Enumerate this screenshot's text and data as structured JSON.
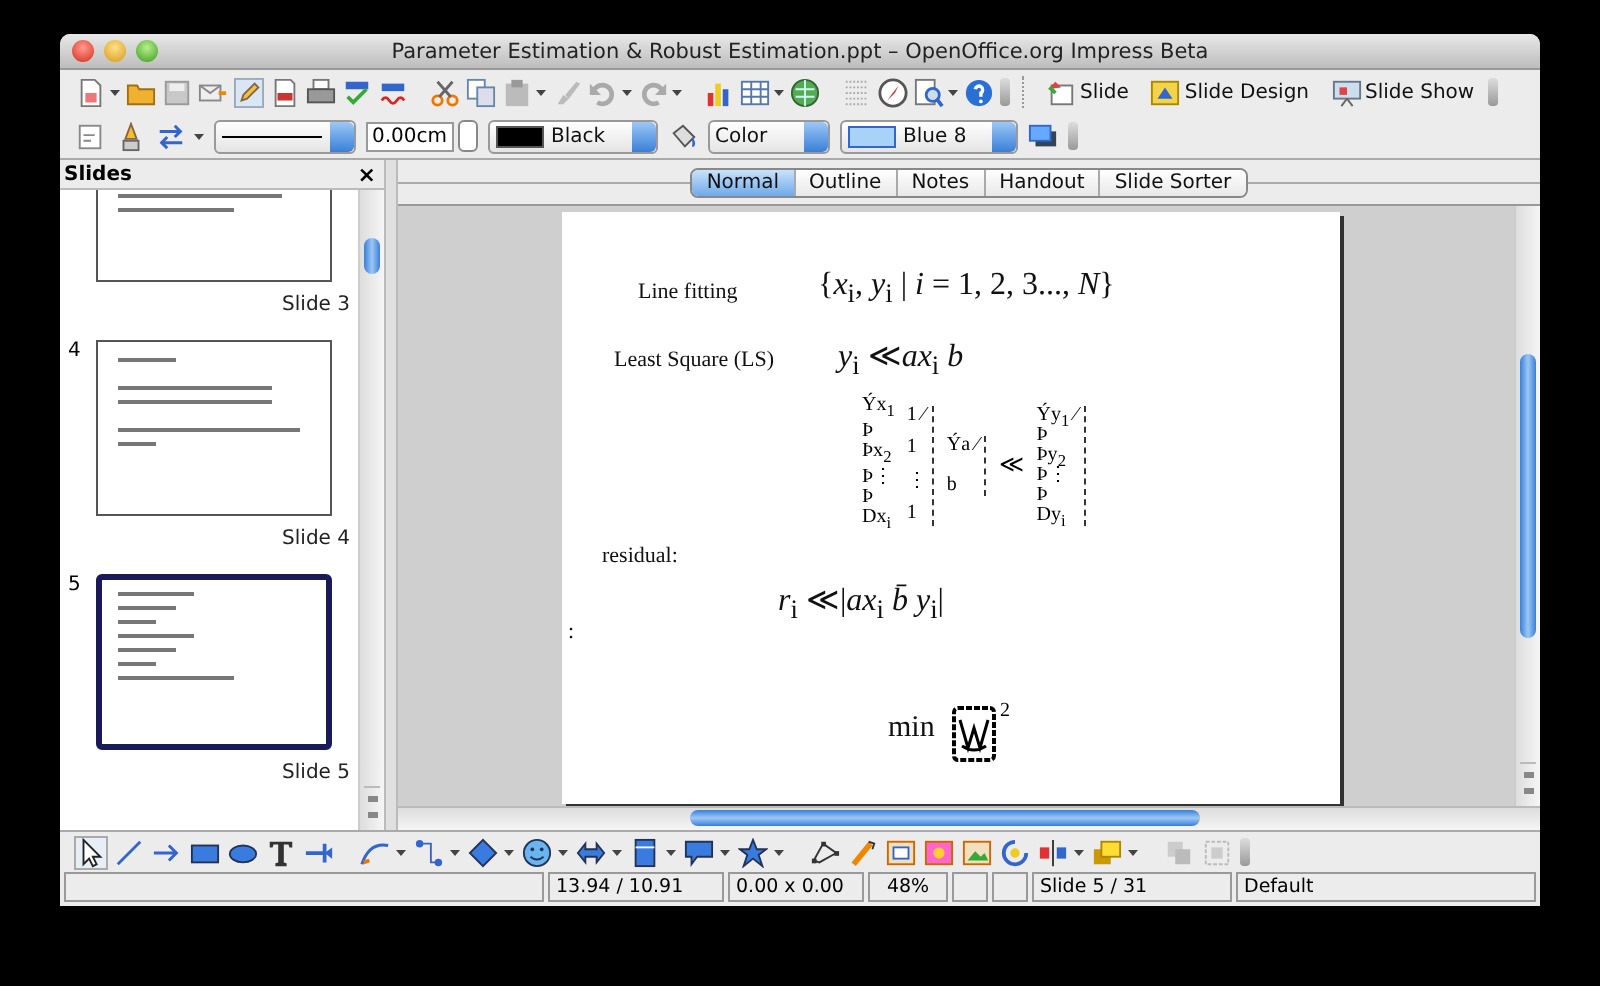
{
  "window": {
    "title": "Parameter Estimation & Robust Estimation.ppt – OpenOffice.org Impress Beta"
  },
  "toolbar_standard": {
    "buttons": [
      {
        "label": "Slide"
      },
      {
        "label": "Slide Design"
      },
      {
        "label": "Slide Show"
      }
    ]
  },
  "toolbar_line_fill": {
    "line_width": "0.00cm",
    "line_color": "Black",
    "area_style": "Color",
    "area_color": "Blue 8"
  },
  "slides_panel": {
    "title": "Slides",
    "close": "×",
    "slides": [
      {
        "label": "Slide 3",
        "selected": false
      },
      {
        "number": "4",
        "label": "Slide 4",
        "selected": false
      },
      {
        "number": "5",
        "label": "Slide 5",
        "selected": true
      }
    ]
  },
  "view_tabs": [
    {
      "label": "Normal",
      "selected": true
    },
    {
      "label": "Outline",
      "selected": false
    },
    {
      "label": "Notes",
      "selected": false
    },
    {
      "label": "Handout",
      "selected": false
    },
    {
      "label": "Slide Sorter",
      "selected": false
    }
  ],
  "slide": {
    "line_fitting": {
      "label": "Line fitting",
      "formula": "{*x*$_{i}$, *y*$_{i}$ | *i* = 1, 2, 3..., *N*}"
    },
    "least_squares": {
      "label": "Least Square (LS)",
      "formula": "*y*$_{i}$ ≪*ax*$_{i}$    *b*",
      "matrix": {
        "column_1": [
          "Ýx$_{1}$",
          "Þ",
          "Þx$_{2}$",
          "Þ⋮",
          "Þ",
          "Dx$_{i}$"
        ],
        "column_2": [
          "1 ⁄",
          "1",
          "⋮",
          "1"
        ],
        "column_3": [
          "Ýa ⁄",
          "b"
        ],
        "operator": "≪",
        "column_4": [
          "Ýy$_{1}$ ⁄",
          "Þ",
          "Þy$_{2}$",
          "Þ⋮",
          "Þ",
          "Dy$_{i}$"
        ]
      }
    },
    "residual": {
      "label": "residual:",
      "formula": "*r*$_{i}$ ≪|*ax*$_{i}$    *b̄*    *y*$_{i}$|"
    },
    "stray_mark": ":",
    "objective": {
      "text": "min",
      "exponent": "2"
    }
  },
  "status_bar": {
    "position": "13.94 / 10.91",
    "size": "0.00 x 0.00",
    "zoom": "48%",
    "page": "Slide 5 / 31",
    "layout": "Default"
  }
}
